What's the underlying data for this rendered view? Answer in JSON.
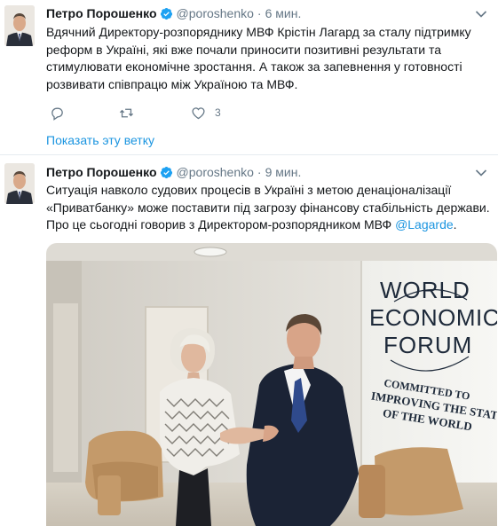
{
  "tweets": [
    {
      "name": "Петро Порошенко",
      "handle": "@poroshenko",
      "separator": "·",
      "time": "6 мин.",
      "text_lines": [
        "Вдячний Директору-розпоряднику МВФ Крістін Лагард за сталу підтримку",
        "реформ в Україні, які вже почали приносити позитивні результати та",
        "стимулювати економічне зростання. А також за запевнення у готовності",
        "розвивати співпрацю між Україною та МВФ."
      ],
      "actions": {
        "reply_icon": "reply-icon",
        "retweet_icon": "retweet-icon",
        "like_icon": "heart-icon",
        "like_count": "3"
      },
      "show_thread": "Показать эту ветку"
    },
    {
      "name": "Петро Порошенко",
      "handle": "@poroshenko",
      "separator": "·",
      "time": "9 мин.",
      "text_lines": [
        "Ситуація навколо судових процесів в Україні з метою денаціоналізації",
        "«Приватбанку» може поставити під загрозу фінансову стабільність держави."
      ],
      "text_line3_prefix": "Про це сьогодні говорив з Директором-розпорядником МВФ ",
      "text_mention": "@Lagarde",
      "text_line3_suffix": ".",
      "photo": {
        "wall_logo": [
          "W",
          "O",
          "R",
          "L",
          "D"
        ],
        "wall_logo_line1": "WORLD",
        "wall_logo_line2": "ECONOMIC",
        "wall_logo_line3": "FORUM",
        "wall_motto_line1": "COMMITTED TO",
        "wall_motto_line2": "IMPROVING THE STATE",
        "wall_motto_line3": "OF THE WORLD"
      }
    }
  ],
  "colors": {
    "link": "#1b95e0",
    "secondary": "#657786",
    "verified": "#1da1f2"
  }
}
